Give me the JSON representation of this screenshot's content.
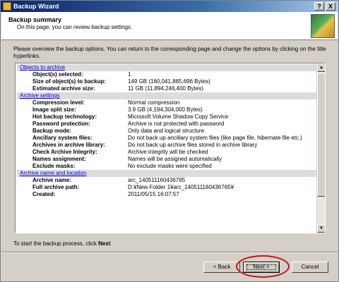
{
  "window": {
    "title": "Backup Wizard",
    "help_btn": "?",
    "close_btn": "X"
  },
  "header": {
    "title": "Backup summary",
    "subtitle": "On this page, you can review backup settings."
  },
  "intro": "Please overview the backup options. You can return to the corresponding page and change the options by clicking on the title hyperlinks.",
  "sections": [
    {
      "title": "Objects to archive",
      "rows": [
        {
          "label": "Object(s) selected:",
          "value": "1"
        },
        {
          "label": "Size of object(s) to backup:",
          "value": "149 GB (160,041,885,696 Bytes)"
        },
        {
          "label": "Estimated archive size:",
          "value": "11 GB (11,894,246,400 Bytes)"
        }
      ]
    },
    {
      "title": "Archive settings",
      "rows": [
        {
          "label": "Compression level:",
          "value": "Normal compression"
        },
        {
          "label": "Image split size:",
          "value": "3.9 GB (4,194,304,000 Bytes)"
        },
        {
          "label": "Hot backup technology:",
          "value": "Microsoft Volume Shadow Copy Service"
        },
        {
          "label": "Password protection:",
          "value": "Archive is not protected with password"
        },
        {
          "label": "Backup mode:",
          "value": "Only data and logical structure"
        },
        {
          "label": "Ancillary system files:",
          "value": "Do not back up ancillary system files (like page file, hibernate file etc.)"
        },
        {
          "label": "Archives in archive library:",
          "value": "Do not back up archive files stored in archive library"
        },
        {
          "label": "Check Archive Integrity:",
          "value": "Archive integrity will be checked"
        },
        {
          "label": "Names assignment:",
          "value": "Names will be assigned automatically"
        },
        {
          "label": "Exclude masks:",
          "value": "No exclude masks were specified"
        }
      ]
    },
    {
      "title": "Archive name and location",
      "rows": [
        {
          "label": "Archive name:",
          "value": "arc_140511160436765"
        },
        {
          "label": "Full archive path:",
          "value": "D:¥New Folder 1¥arc_140511160436765¥"
        },
        {
          "label": "Created:",
          "value": "2011/05/15 16:07:57"
        }
      ]
    }
  ],
  "footer": {
    "prefix": "To start the backup process, click ",
    "action": "Next"
  },
  "buttons": {
    "back": "< Back",
    "next": "Next >",
    "cancel": "Cancel"
  },
  "colors": {
    "title_start": "#0a246a",
    "link": "#0000ee",
    "highlight_ring": "#d01010"
  }
}
